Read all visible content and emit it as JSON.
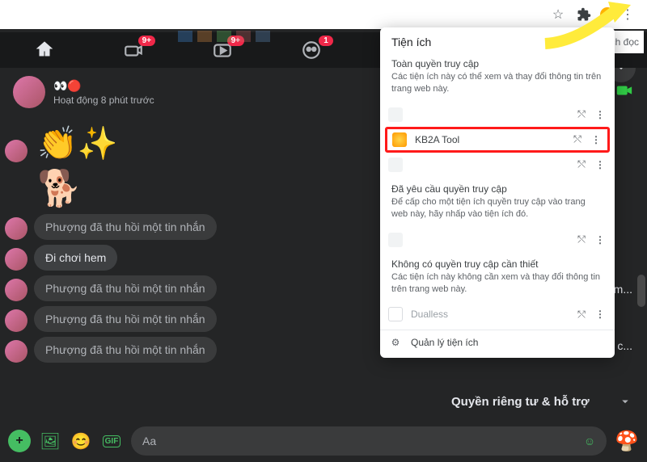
{
  "browser": {
    "reading_list_fragment": "h sách đọc"
  },
  "fb_nav": {
    "badge_9plus": "9+",
    "badge_1": "1"
  },
  "chat": {
    "name_emoji": "👀🔴",
    "status": "Hoạt động 8 phút trước",
    "recalled": "Phượng đã thu hồi một tin nhắn",
    "solid_msg": "Đi chơi hem",
    "composer_placeholder": "Aa"
  },
  "right": {
    "privacy_label": "Quyền riêng tư & hỗ trợ",
    "letters": {
      "m": "m...",
      "c": "c..."
    }
  },
  "ext": {
    "title": "Tiện ích",
    "full_access_h": "Toàn quyền truy cập",
    "full_access_d": "Các tiện ích này có thể xem và thay đổi thông tin trên trang web này.",
    "kb2a": "KB2A Tool",
    "requested_h": "Đã yêu cầu quyền truy cập",
    "requested_d": "Để cấp cho một tiện ích quyền truy cập vào trang web này, hãy nhấp vào tiện ích đó.",
    "noaccess_h": "Không có quyền truy cập cần thiết",
    "noaccess_d": "Các tiện ích này không cần xem và thay đổi thông tin trên trang web này.",
    "dualless": "Dualless",
    "manage": "Quản lý tiện ích"
  }
}
